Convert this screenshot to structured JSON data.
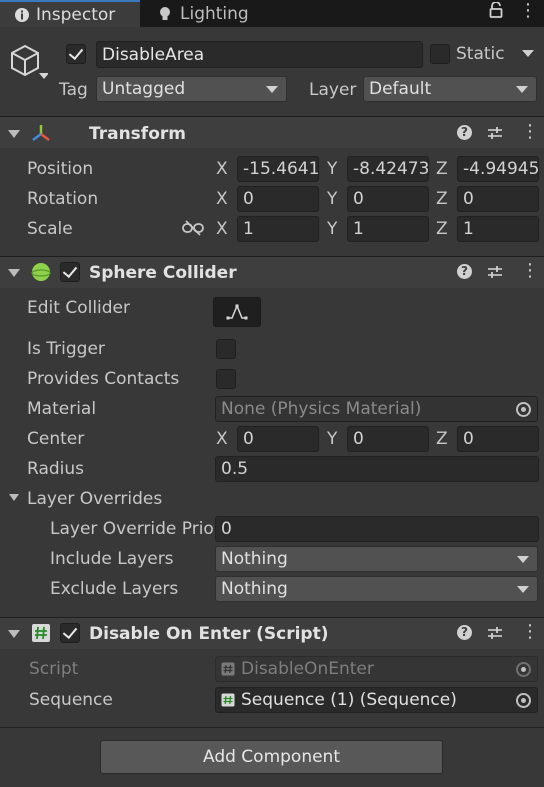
{
  "tabs": {
    "inspector": "Inspector",
    "lighting": "Lighting"
  },
  "object": {
    "name": "DisableArea",
    "active": true,
    "static_label": "Static",
    "static": false,
    "tag_label": "Tag",
    "tag_value": "Untagged",
    "layer_label": "Layer",
    "layer_value": "Default"
  },
  "transform": {
    "title": "Transform",
    "position_label": "Position",
    "rotation_label": "Rotation",
    "scale_label": "Scale",
    "position": {
      "x": "-15.4641",
      "y": "-8.42473",
      "z": "-4.94945"
    },
    "rotation": {
      "x": "0",
      "y": "0",
      "z": "0"
    },
    "scale": {
      "x": "1",
      "y": "1",
      "z": "1"
    },
    "axis_x": "X",
    "axis_y": "Y",
    "axis_z": "Z"
  },
  "sphere_collider": {
    "title": "Sphere Collider",
    "enabled": true,
    "edit_collider_label": "Edit Collider",
    "is_trigger_label": "Is Trigger",
    "is_trigger": false,
    "provides_contacts_label": "Provides Contacts",
    "provides_contacts": false,
    "material_label": "Material",
    "material_value": "None (Physics Material)",
    "center_label": "Center",
    "center": {
      "x": "0",
      "y": "0",
      "z": "0"
    },
    "radius_label": "Radius",
    "radius": "0.5",
    "layer_overrides_label": "Layer Overrides",
    "layer_override_priority_label": "Layer Override Prio",
    "layer_override_priority": "0",
    "include_layers_label": "Include Layers",
    "include_layers": "Nothing",
    "exclude_layers_label": "Exclude Layers",
    "exclude_layers": "Nothing"
  },
  "script_component": {
    "title": "Disable On Enter (Script)",
    "enabled": true,
    "script_label": "Script",
    "script_value": "DisableOnEnter",
    "sequence_label": "Sequence",
    "sequence_value": "Sequence (1) (Sequence)"
  },
  "add_component_label": "Add Component",
  "header_icons": {
    "help": "?",
    "more": "⋮"
  }
}
